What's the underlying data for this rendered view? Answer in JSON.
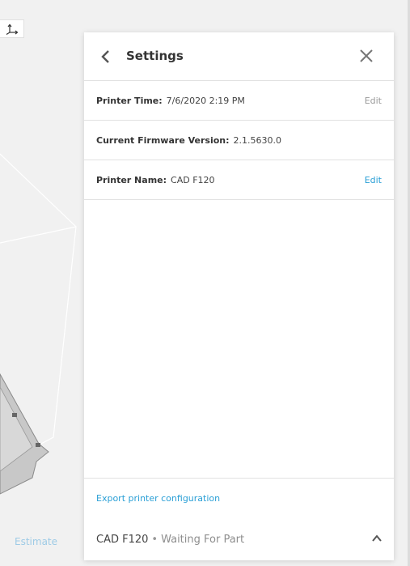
{
  "viewport": {
    "estimate_label": "Estimate"
  },
  "settings_panel": {
    "title": "Settings",
    "rows": [
      {
        "label": "Printer Time:",
        "value": "7/6/2020 2:19 PM",
        "edit_label": "Edit"
      },
      {
        "label": "Current Firmware Version:",
        "value": "2.1.5630.0"
      },
      {
        "label": "Printer Name:",
        "value": "CAD F120",
        "edit_label": "Edit"
      }
    ],
    "export_label": "Export printer configuration"
  },
  "status_bar": {
    "printer_name": "CAD F120",
    "separator": "•",
    "status": "Waiting For Part"
  },
  "colors": {
    "accent": "#2a9fd6",
    "muted": "#9a9a9a",
    "estimate": "#9ecbe6"
  }
}
